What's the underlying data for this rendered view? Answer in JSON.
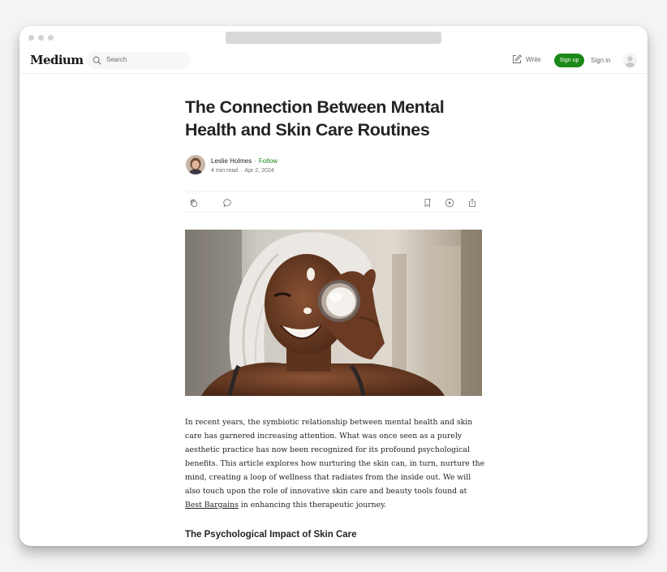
{
  "browser": {
    "url": ""
  },
  "header": {
    "logo": "Medium",
    "search_placeholder": "Search",
    "write_label": "Write",
    "signup_label": "Sign up",
    "signin_label": "Sign in"
  },
  "article": {
    "title": "The Connection Between Mental Health and Skin Care Routines",
    "author": "Leslie Holmes",
    "follow_label": "Follow",
    "separator": "·",
    "read_time": "4 min read",
    "date": "Apr 2, 2024",
    "paragraph_main": "In recent years, the symbiotic relationship between mental health and skin care has garnered increasing attention. What was once seen as a purely aesthetic practice has now been recognized for its profound psychological benefits. This article explores how nurturing the skin can, in turn, nurture the mind, creating a loop of wellness that radiates from the inside out. We will also touch upon the role of innovative skin care and beauty tools found at",
    "link_text": "Best Bargains",
    "paragraph_tail": " in enhancing this therapeutic journey.",
    "subheading": "The Psychological Impact of Skin Care"
  },
  "icons": {
    "search": "search-icon",
    "write": "write-icon",
    "clap": "clap-icon",
    "comment": "comment-icon",
    "bookmark": "bookmark-icon",
    "listen": "play-icon",
    "share": "share-icon"
  },
  "colors": {
    "accent": "#1a8917",
    "text": "#242424",
    "muted": "#6b6b6b"
  }
}
